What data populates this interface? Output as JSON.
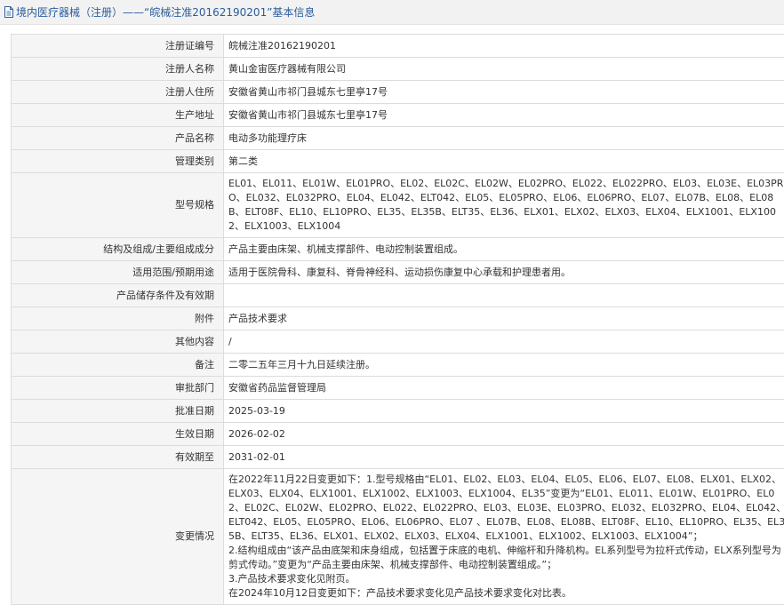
{
  "header": {
    "title": "境内医疗器械（注册）——“皖械注准20162190201”基本信息"
  },
  "rows": [
    {
      "label": "注册证编号",
      "value": "皖械注准20162190201"
    },
    {
      "label": "注册人名称",
      "value": "黄山金宙医疗器械有限公司"
    },
    {
      "label": "注册人住所",
      "value": "安徽省黄山市祁门县城东七里亭17号"
    },
    {
      "label": "生产地址",
      "value": "安徽省黄山市祁门县城东七里亭17号"
    },
    {
      "label": "产品名称",
      "value": "电动多功能理疗床"
    },
    {
      "label": "管理类别",
      "value": "第二类"
    },
    {
      "label": "型号规格",
      "value": "EL01、EL011、EL01W、EL01PRO、EL02、EL02C、EL02W、EL02PRO、EL022、EL022PRO、EL03、EL03E、EL03PRO、EL032、EL032PRO、EL04、EL042、ELT042、EL05、EL05PRO、EL06、EL06PRO、EL07、EL07B、EL08、EL08B、ELT08F、EL10、EL10PRO、EL35、EL35B、ELT35、EL36、ELX01、ELX02、ELX03、ELX04、ELX1001、ELX1002、ELX1003、ELX1004"
    },
    {
      "label": "结构及组成/主要组成成分",
      "value": "产品主要由床架、机械支撑部件、电动控制装置组成。"
    },
    {
      "label": "适用范围/预期用途",
      "value": "适用于医院骨科、康复科、脊骨神经科、运动损伤康复中心承载和护理患者用。"
    },
    {
      "label": "产品储存条件及有效期",
      "value": ""
    },
    {
      "label": "附件",
      "value": "产品技术要求"
    },
    {
      "label": "其他内容",
      "value": "/"
    },
    {
      "label": "备注",
      "value": "二零二五年三月十九日延续注册。"
    },
    {
      "label": "审批部门",
      "value": "安徽省药品监督管理局"
    },
    {
      "label": "批准日期",
      "value": "2025-03-19"
    },
    {
      "label": "生效日期",
      "value": "2026-02-02"
    },
    {
      "label": "有效期至",
      "value": "2031-02-01"
    }
  ],
  "changes": {
    "label": "变更情况",
    "paragraphs": [
      "在2022年11月22日变更如下：1.型号规格由“EL01、EL02、EL03、EL04、EL05、EL06、EL07、EL08、ELX01、ELX02、ELX03、ELX04、ELX1001、ELX1002、ELX1003、ELX1004、EL35”变更为“EL01、EL011、EL01W、EL01PRO、EL02、EL02C、EL02W、EL02PRO、EL022、EL022PRO、EL03、EL03E、EL03PRO、EL032、EL032PRO、EL04、EL042、ELT042、EL05、EL05PRO、EL06、EL06PRO、EL07 、EL07B、EL08、EL08B、ELT08F、EL10、EL10PRO、EL35、EL35B、ELT35、EL36、ELX01、ELX02、ELX03、ELX04、ELX1001、ELX1002、ELX1003、ELX1004”；",
      "2.结构组成由“该产品由底架和床身组成，包括置于床底的电机、伸缩杆和升降机构。EL系列型号为拉杆式传动，ELX系列型号为剪式传动。”变更为“产品主要由床架、机械支撑部件、电动控制装置组成。”；",
      "3.产品技术要求变化见附页。",
      "在2024年10月12日变更如下：产品技术要求变化见产品技术要求变化对比表。"
    ]
  }
}
